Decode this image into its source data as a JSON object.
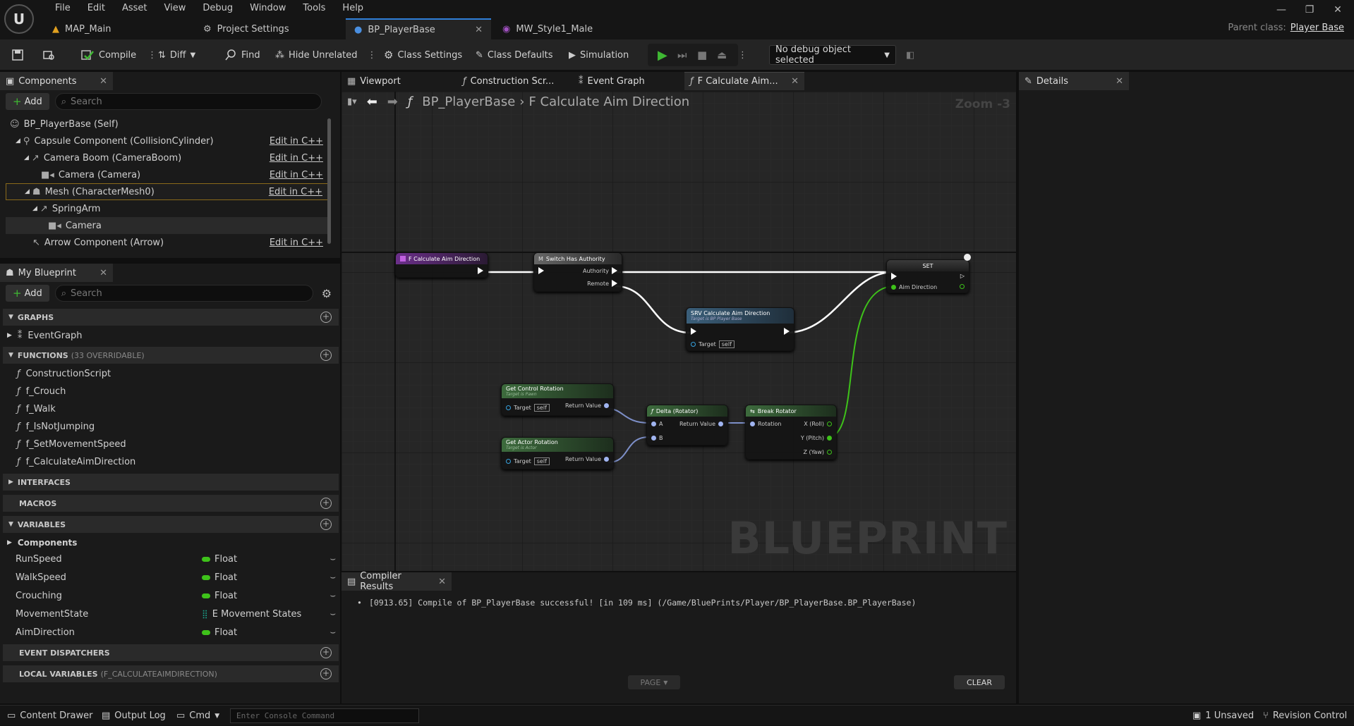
{
  "menu": [
    "File",
    "Edit",
    "Asset",
    "View",
    "Debug",
    "Window",
    "Tools",
    "Help"
  ],
  "doc_tabs": [
    {
      "label": "MAP_Main",
      "icon": "level-icon"
    },
    {
      "label": "Project Settings",
      "icon": "settings-icon"
    },
    {
      "label": "BP_PlayerBase",
      "icon": "blueprint-character-icon",
      "active": true
    },
    {
      "label": "MW_Style1_Male",
      "icon": "material-icon"
    }
  ],
  "parent_class": {
    "label": "Parent class:",
    "value": "Player Base"
  },
  "toolbar": {
    "compile": "Compile",
    "diff": "Diff",
    "find": "Find",
    "hide_unrelated": "Hide Unrelated",
    "class_settings": "Class Settings",
    "class_defaults": "Class Defaults",
    "simulation": "Simulation",
    "debug_select": "No debug object selected"
  },
  "components_panel": {
    "title": "Components",
    "add": "Add",
    "search_placeholder": "Search",
    "items": [
      {
        "label": "BP_PlayerBase (Self)",
        "edit": ""
      },
      {
        "label": "Capsule Component (CollisionCylinder)",
        "edit": "Edit in C++"
      },
      {
        "label": "Camera Boom (CameraBoom)",
        "edit": "Edit in C++"
      },
      {
        "label": "Camera (Camera)",
        "edit": "Edit in C++"
      },
      {
        "label": "Mesh (CharacterMesh0)",
        "edit": "Edit in C++"
      },
      {
        "label": "SpringArm",
        "edit": ""
      },
      {
        "label": "Camera",
        "edit": ""
      },
      {
        "label": "Arrow Component (Arrow)",
        "edit": "Edit in C++"
      }
    ]
  },
  "my_blueprint": {
    "title": "My Blueprint",
    "add": "Add",
    "search_placeholder": "Search",
    "graphs_label": "GRAPHS",
    "event_graph": "EventGraph",
    "functions_label": "FUNCTIONS",
    "functions_overridable": "(33 OVERRIDABLE)",
    "functions": [
      "ConstructionScript",
      "f_Crouch",
      "f_Walk",
      "f_IsNotJumping",
      "f_SetMovementSpeed",
      "f_CalculateAimDirection"
    ],
    "interfaces_label": "INTERFACES",
    "macros_label": "MACROS",
    "variables_label": "VARIABLES",
    "components_category": "Components",
    "variables": [
      {
        "name": "RunSpeed",
        "type": "Float"
      },
      {
        "name": "WalkSpeed",
        "type": "Float"
      },
      {
        "name": "Crouching",
        "type": "Float"
      },
      {
        "name": "MovementState",
        "type": "E Movement States"
      },
      {
        "name": "AimDirection",
        "type": "Float"
      }
    ],
    "event_dispatchers_label": "EVENT DISPATCHERS",
    "local_variables_label": "LOCAL VARIABLES",
    "local_variables_sub": "(F_CALCULATEAIMDIRECTION)"
  },
  "graph_tabs": [
    "Viewport",
    "Construction Scr...",
    "Event Graph",
    "F Calculate Aim..."
  ],
  "breadcrumb": {
    "blueprint": "BP_PlayerBase",
    "function": "F Calculate Aim Direction",
    "zoom": "Zoom -3"
  },
  "nodes": {
    "entry": "F Calculate Aim Direction",
    "switch": "Switch Has Authority",
    "authority": "Authority",
    "remote": "Remote",
    "srv": "SRV Calculate Aim Direction",
    "srv_sub": "Target is BP Player Base",
    "target": "Target",
    "self": "self",
    "get_control": "Get Control Rotation",
    "get_control_sub": "Target is Pawn",
    "get_actor": "Get Actor Rotation",
    "get_actor_sub": "Target is Actor",
    "return_value": "Return Value",
    "delta": "Delta (Rotator)",
    "a": "A",
    "b": "B",
    "break": "Break Rotator",
    "rotation": "Rotation",
    "x_roll": "X (Roll)",
    "y_pitch": "Y (Pitch)",
    "z_yaw": "Z (Yaw)",
    "set": "SET",
    "aim_direction": "Aim Direction"
  },
  "watermark": "BLUEPRINT",
  "details": {
    "title": "Details"
  },
  "compiler": {
    "title": "Compiler Results",
    "message": "[0913.65] Compile of BP_PlayerBase successful! [in 109 ms] (/Game/BluePrints/Player/BP_PlayerBase.BP_PlayerBase)",
    "page": "PAGE",
    "clear": "CLEAR"
  },
  "statusbar": {
    "content_drawer": "Content Drawer",
    "output_log": "Output Log",
    "cmd": "Cmd",
    "console_placeholder": "Enter Console Command",
    "unsaved": "1 Unsaved",
    "revision": "Revision Control"
  },
  "colors": {
    "accent": "#2f7fd8",
    "float_pin": "#3ec21a",
    "exec_pin": "#ffffff",
    "play": "#3fb833",
    "function_header": "#6b2f8a",
    "pure_header": "#3d6b3d",
    "srv_header": "#3b5f7a"
  }
}
